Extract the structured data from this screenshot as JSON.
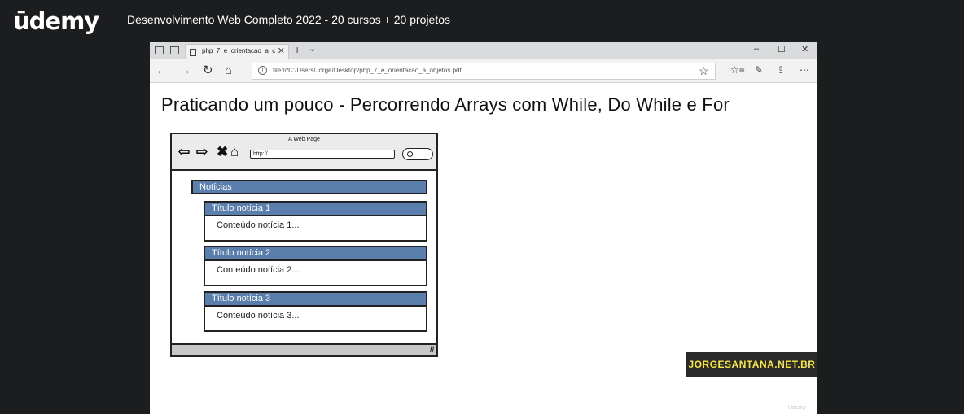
{
  "udemy": {
    "logo": "ūdemy",
    "course_title": "Desenvolvimento Web Completo 2022 - 20 cursos + 20 projetos"
  },
  "browser": {
    "tab_label": "php_7_e_orientacao_a_c",
    "tab_close": "✕",
    "new_tab": "+",
    "tab_dropdown": "⌄",
    "window_controls": {
      "minimize": "–",
      "maximize": "☐",
      "close": "✕"
    },
    "url": "file:///C:/Users/Jorge/Desktop/php_7_e_orientacao_a_objetos.pdf",
    "nav": {
      "back": "←",
      "forward": "→",
      "refresh": "↻",
      "home": "⌂"
    },
    "tools": {
      "favorites": "☆",
      "reading_list": "☆≡",
      "notes": "✎",
      "share": "⇪",
      "more": "⋯"
    }
  },
  "slide": {
    "title": "Praticando um pouco - Percorrendo Arrays com While, Do While e For",
    "mockup": {
      "window_title": "A Web Page",
      "url_text": "http://",
      "section_header": "Notícias",
      "cards": [
        {
          "title": "Título notícia 1",
          "content": "Conteúdo notícia 1..."
        },
        {
          "title": "Título notícia 2",
          "content": "Conteúdo notícia 2..."
        },
        {
          "title": "Título notícia 3",
          "content": "Conteúdo notícia 3..."
        }
      ]
    },
    "watermark": "JORGESANTANA.NET.BR",
    "corner_mark": "Udemy"
  },
  "colors": {
    "udemy_purple": "#a435f0",
    "header_bg": "#1c1d1f",
    "mockup_blue": "#5b7fad",
    "watermark_text": "#f5e642"
  },
  "icons": [
    "udemy-logo",
    "tab-actions-icon",
    "set-aside-tabs-icon",
    "pdf-icon",
    "back-arrow-icon",
    "forward-arrow-icon",
    "refresh-icon",
    "home-icon",
    "info-icon",
    "star-icon",
    "favorites-icon",
    "pen-icon",
    "share-icon",
    "more-icon",
    "search-icon"
  ]
}
